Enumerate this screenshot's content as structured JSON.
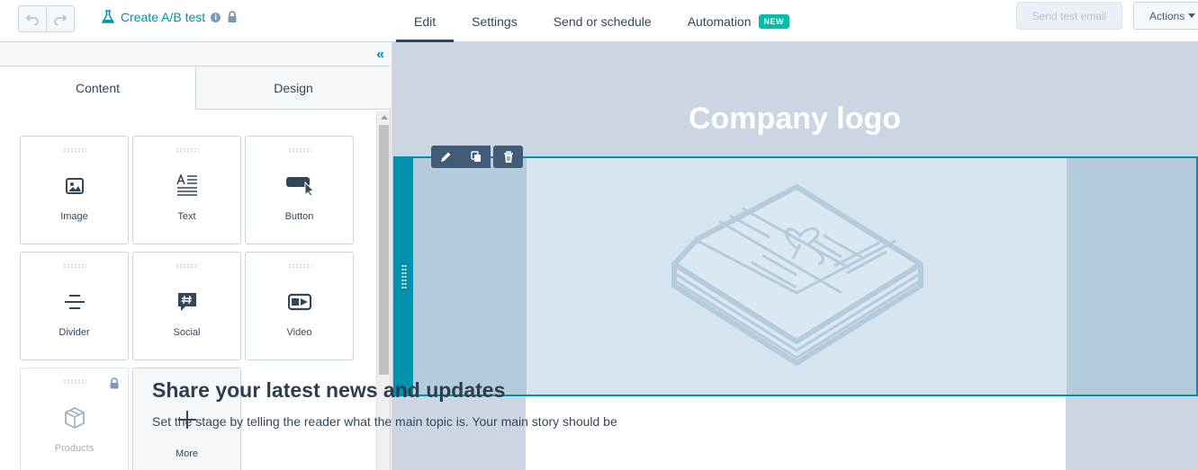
{
  "topbar": {
    "undo_label": "Undo",
    "redo_label": "Redo",
    "abtest_label": "Create A/B test",
    "info_glyph": "i",
    "tabs": [
      {
        "label": "Edit"
      },
      {
        "label": "Settings"
      },
      {
        "label": "Send or schedule"
      },
      {
        "label": "Automation",
        "badge": "NEW"
      }
    ],
    "send_test_label": "Send test email",
    "actions_label": "Actions"
  },
  "sidebar": {
    "collapse_glyph": "«",
    "tabs": [
      {
        "label": "Content"
      },
      {
        "label": "Design"
      }
    ],
    "modules": [
      {
        "label": "Image",
        "icon": "image-icon"
      },
      {
        "label": "Text",
        "icon": "text-icon"
      },
      {
        "label": "Button",
        "icon": "button-icon"
      },
      {
        "label": "Divider",
        "icon": "divider-icon"
      },
      {
        "label": "Social",
        "icon": "social-icon"
      },
      {
        "label": "Video",
        "icon": "video-icon"
      },
      {
        "label": "Products",
        "icon": "products-icon",
        "locked": true
      },
      {
        "label": "More",
        "icon": "plus-icon"
      }
    ]
  },
  "canvas": {
    "logo_text": "Company logo",
    "headline": "Share your latest news and updates",
    "body": "Set the stage by telling the reader what the main topic is. Your main story should be"
  },
  "colors": {
    "accent": "#0091ae",
    "badge": "#00bda5",
    "canvas_bg": "#cbd6e2",
    "toolbar": "#425b76"
  }
}
